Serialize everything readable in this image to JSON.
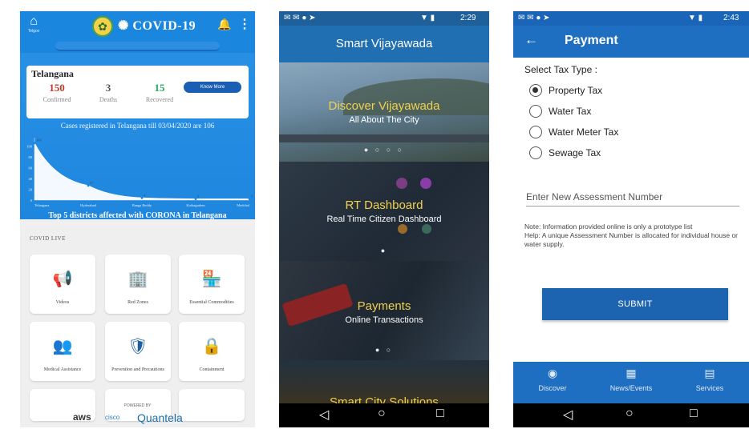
{
  "covid": {
    "title": "COVID-19",
    "emblem_caption": "Telgov",
    "state": "Telangana",
    "confirmed": "150",
    "confirmed_label": "Confirmed",
    "deaths": "3",
    "deaths_label": "Deaths",
    "recovered": "15",
    "recovered_label": "Recovered",
    "more_button": "Know More",
    "registered_note": "Cases registered in Telangana till 03/04/2020 are 106",
    "chart_heading": "Top 5 districts affected with CORONA in Telangana",
    "live_title": "COVID LIVE",
    "tiles": [
      {
        "label": "Videos",
        "icon": "megaphone-icon"
      },
      {
        "label": "Red Zones",
        "icon": "building-icon"
      },
      {
        "label": "Essential Commodities",
        "icon": "store-icon"
      },
      {
        "label": "Medical Assistance",
        "icon": "doctor-icon"
      },
      {
        "label": "Prevention and Precautions",
        "icon": "shield-icon"
      },
      {
        "label": "Containment",
        "icon": "lock-icon"
      }
    ],
    "powered_by": "POWERED BY",
    "brands": [
      "aws",
      "cisco",
      "Quantela"
    ],
    "colors": {
      "confirmed": "#c0392b",
      "recovered": "#27ae60",
      "primary": "#1b86de"
    }
  },
  "chart_data": {
    "type": "area",
    "categories": [
      "Telangana",
      "Hyderabad",
      "Ranga Reddy",
      "Kothagudem",
      "Medchal"
    ],
    "values": [
      106,
      27,
      4,
      2,
      2
    ],
    "data_labels": [
      "106",
      "27",
      "4",
      "2",
      "2"
    ],
    "ylim": [
      0,
      110
    ],
    "y_ticks": [
      "0",
      "20",
      "40",
      "60",
      "80",
      "100"
    ],
    "grid": false
  },
  "smart": {
    "status_time": "2:29",
    "title": "Smart Vijayawada",
    "panels": [
      {
        "heading": "Discover Vijayawada",
        "sub": "All About The City",
        "dots": "● ○ ○ ○"
      },
      {
        "heading": "RT Dashboard",
        "sub": "Real Time Citizen Dashboard",
        "dots": "●"
      },
      {
        "heading": "Payments",
        "sub": "Online Transactions",
        "dots": "● ○"
      },
      {
        "heading": "Smart City Solutions",
        "sub": "",
        "dots": ""
      }
    ]
  },
  "payment": {
    "status_time": "2:43",
    "title": "Payment",
    "select_label": "Select Tax Type :",
    "options": [
      "Property Tax",
      "Water Tax",
      "Water Meter Tax",
      "Sewage Tax"
    ],
    "selected": "Property Tax",
    "assessment_placeholder": "Enter New Assessment Number",
    "note_line1": "Note: Information provided online is only a prototype list",
    "note_line2": "Help: A unique Assessment Number is allocated for individual house or water supply.",
    "submit": "SUBMIT",
    "tabs": [
      "Discover",
      "News/Events",
      "Services"
    ]
  }
}
